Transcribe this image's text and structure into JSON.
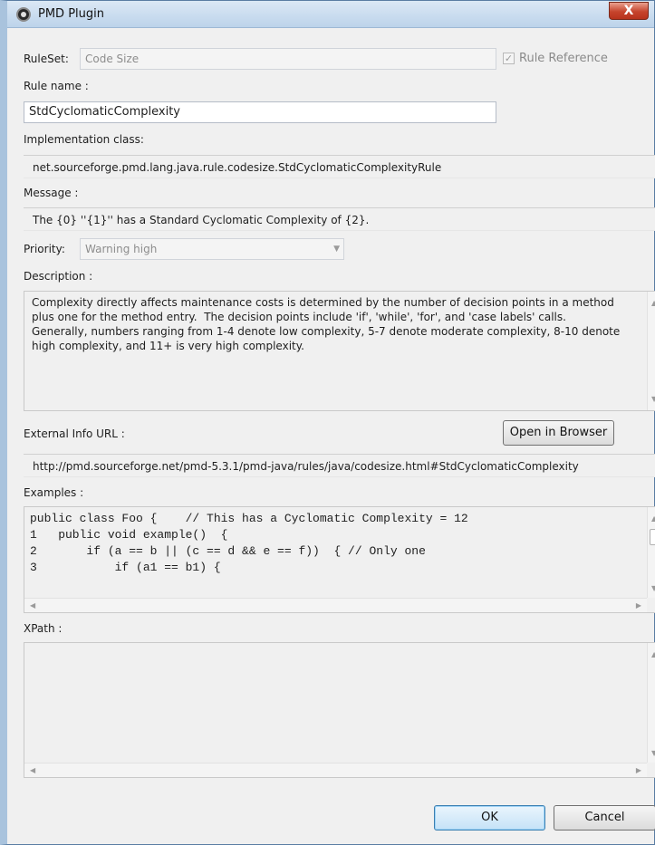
{
  "window": {
    "title": "PMD Plugin",
    "close_glyph": "X"
  },
  "ruleset": {
    "label": "RuleSet:",
    "value": "Code Size",
    "rule_reference_label": "Rule Reference",
    "rule_reference_checked": true
  },
  "rule_name": {
    "label": "Rule name :",
    "value": "StdCyclomaticComplexity"
  },
  "implementation": {
    "label": "Implementation class:",
    "value": "net.sourceforge.pmd.lang.java.rule.codesize.StdCyclomaticComplexityRule"
  },
  "message": {
    "label": "Message :",
    "value": "The {0} ''{1}'' has a Standard Cyclomatic Complexity of {2}."
  },
  "priority": {
    "label": "Priority:",
    "value": "Warning high"
  },
  "description": {
    "label": "Description :",
    "text": "Complexity directly affects maintenance costs is determined by the number of decision points in a method\nplus one for the method entry.  The decision points include 'if', 'while', 'for', and 'case labels' calls.\nGenerally, numbers ranging from 1-4 denote low complexity, 5-7 denote moderate complexity, 8-10 denote\nhigh complexity, and 11+ is very high complexity."
  },
  "external_info": {
    "label": "External Info URL :",
    "open_button": "Open in Browser",
    "url": "http://pmd.sourceforge.net/pmd-5.3.1/pmd-java/rules/java/codesize.html#StdCyclomaticComplexity"
  },
  "examples": {
    "label": "Examples :",
    "code": "public class Foo {    // This has a Cyclomatic Complexity = 12\n1   public void example()  {\n2       if (a == b || (c == d && e == f))  { // Only one\n3           if (a1 == b1) {"
  },
  "xpath": {
    "label": "XPath :",
    "value": ""
  },
  "buttons": {
    "ok": "OK",
    "cancel": "Cancel"
  },
  "icons": {
    "app": "pmd-plugin-icon",
    "check": "✓",
    "up": "▲",
    "down": "▼",
    "left": "◀",
    "right": "▶"
  }
}
